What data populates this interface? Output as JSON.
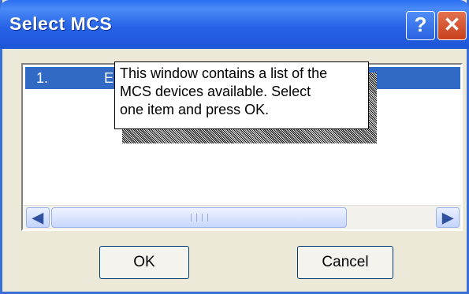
{
  "window": {
    "title": "Select MCS",
    "help_glyph": "?",
    "close_glyph": "✕"
  },
  "list": {
    "items": [
      {
        "index": "1.",
        "name": "Ea"
      }
    ]
  },
  "scrollbar": {
    "left_glyph": "◀",
    "right_glyph": "▶"
  },
  "buttons": {
    "ok": "OK",
    "cancel": "Cancel"
  },
  "tooltip": {
    "lines": [
      "This window contains a list of the",
      "MCS devices available.  Select",
      "one item and press OK."
    ]
  },
  "colors": {
    "title_bar": "#2763e6",
    "selection": "#316ac5",
    "close_button": "#c8401d"
  }
}
